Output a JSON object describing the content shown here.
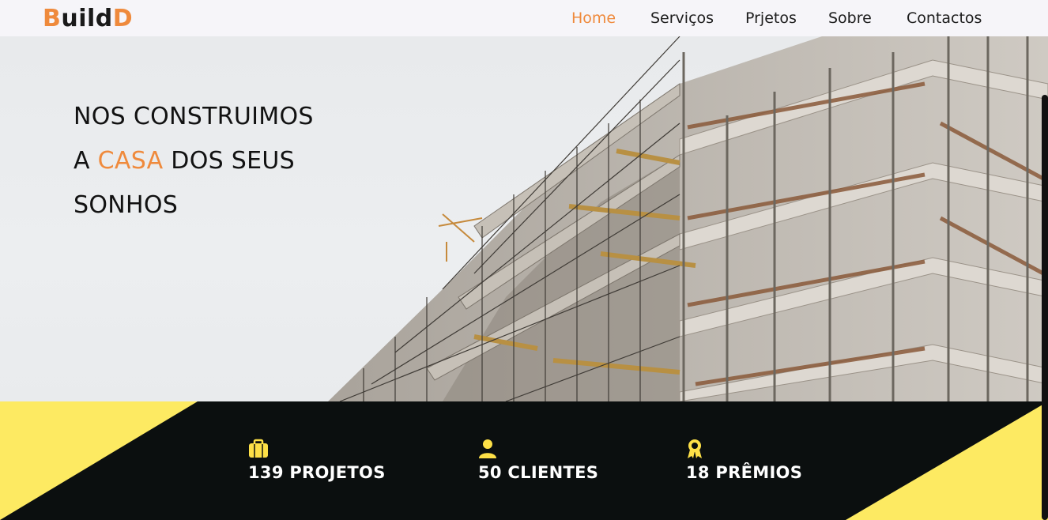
{
  "header": {
    "logo": {
      "first_letter": "B",
      "middle": "uild",
      "last_letter": "D"
    },
    "nav": [
      {
        "label": "Home",
        "active": true
      },
      {
        "label": "Serviços",
        "active": false
      },
      {
        "label": "Prjetos",
        "active": false
      },
      {
        "label": "Sobre",
        "active": false
      },
      {
        "label": "Contactos",
        "active": false
      }
    ]
  },
  "hero": {
    "line1": "NOS CONSTRUIMOS",
    "line2_prefix": "A ",
    "line2_highlight": "CASA",
    "line2_suffix": " DOS SEUS",
    "line3": "SONHOS"
  },
  "stats": [
    {
      "icon": "briefcase-icon",
      "label": "139 PROJETOS"
    },
    {
      "icon": "user-icon",
      "label": "50 CLIENTES"
    },
    {
      "icon": "award-icon",
      "label": "18 PRÊMIOS"
    }
  ],
  "colors": {
    "accent": "#ef8a3c",
    "stats_bg": "#0b0f0f",
    "stats_yellow": "#fdea62"
  }
}
